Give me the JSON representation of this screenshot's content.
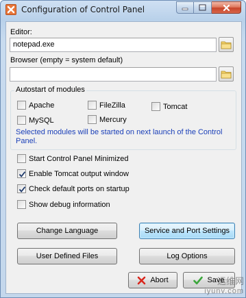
{
  "window": {
    "title": "Configuration of Control Panel",
    "icons": {
      "app": "xampp-icon",
      "minimize": "minimize-icon",
      "maximize": "maximize-icon",
      "close": "close-icon"
    }
  },
  "editor": {
    "label": "Editor:",
    "value": "notepad.exe"
  },
  "browser": {
    "label": "Browser (empty = system default)",
    "value": ""
  },
  "autostart": {
    "title": "Autostart of modules",
    "modules": [
      {
        "label": "Apache",
        "checked": false
      },
      {
        "label": "FileZilla",
        "checked": false
      },
      {
        "label": "Tomcat",
        "checked": false
      },
      {
        "label": "MySQL",
        "checked": false
      },
      {
        "label": "Mercury",
        "checked": false
      }
    ],
    "note": "Selected modules will be started on next launch of the Control Panel."
  },
  "options": [
    {
      "label": "Start Control Panel Minimized",
      "checked": false
    },
    {
      "label": "Enable Tomcat output window",
      "checked": true
    },
    {
      "label": "Check default ports on startup",
      "checked": true
    },
    {
      "label": "Show debug information",
      "checked": false
    }
  ],
  "buttons": {
    "change_language": "Change Language",
    "service_port": "Service and Port Settings",
    "user_files": "User Defined Files",
    "log_options": "Log Options",
    "abort": "Abort",
    "save": "Save"
  },
  "colors": {
    "note_text": "#1a3fb8",
    "abort_icon": "#d9261c",
    "save_icon": "#3aa63a"
  },
  "watermark": {
    "line1": "运维网",
    "line2": "iyunv.com"
  }
}
